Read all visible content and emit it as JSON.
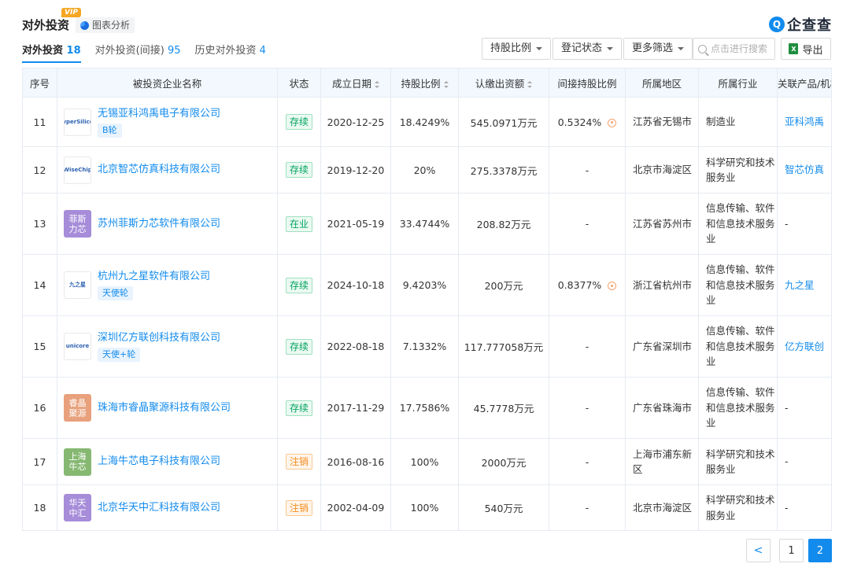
{
  "header": {
    "title": "对外投资",
    "vip": "VIP",
    "chart_button": "图表分析",
    "brand_icon": "Q",
    "brand_name": "企查查"
  },
  "tabs": [
    {
      "label": "对外投资",
      "count": "18"
    },
    {
      "label": "对外投资(间接)",
      "count": "95"
    },
    {
      "label": "历史对外投资",
      "count": "4"
    }
  ],
  "filters": {
    "ratio": "持股比例",
    "status": "登记状态",
    "more": "更多筛选",
    "search_placeholder": "点击进行搜索",
    "export": "导出",
    "excel_icon": "X"
  },
  "columns": [
    "序号",
    "被投资企业名称",
    "状态",
    "成立日期",
    "持股比例",
    "认缴出资额",
    "间接持股比例",
    "所属地区",
    "所属行业",
    "关联产品/机构"
  ],
  "rows": [
    {
      "no": "11",
      "logo_text": "HyperSilicon",
      "logo_bg": "#ffffff",
      "name": "无锡亚科鸿禹电子有限公司",
      "round": "B轮",
      "status": "存续",
      "status_color": "green",
      "date": "2020-12-25",
      "ratio": "18.4249%",
      "capital": "545.0971万元",
      "indirect": "0.5324%",
      "region": "江苏省无锡市",
      "industry": "制造业",
      "product": "亚科鸿禹"
    },
    {
      "no": "12",
      "logo_text": "WiseChip",
      "logo_bg": "#ffffff",
      "name": "北京智芯仿真科技有限公司",
      "round": "",
      "status": "存续",
      "status_color": "green",
      "date": "2019-12-20",
      "ratio": "20%",
      "capital": "275.3378万元",
      "indirect": "-",
      "region": "北京市海淀区",
      "industry": "科学研究和技术服务业",
      "product": "智芯仿真"
    },
    {
      "no": "13",
      "logo_text": "菲斯力芯",
      "logo_bg": "#a68cd9",
      "name": "苏州菲斯力芯软件有限公司",
      "round": "",
      "status": "在业",
      "status_color": "green",
      "date": "2021-05-19",
      "ratio": "33.4744%",
      "capital": "208.82万元",
      "indirect": "-",
      "region": "江苏省苏州市",
      "industry": "信息传输、软件和信息技术服务业",
      "product": "-"
    },
    {
      "no": "14",
      "logo_text": "九之星",
      "logo_bg": "#ffffff",
      "name": "杭州九之星软件有限公司",
      "round": "天使轮",
      "status": "存续",
      "status_color": "green",
      "date": "2024-10-18",
      "ratio": "9.4203%",
      "capital": "200万元",
      "indirect": "0.8377%",
      "region": "浙江省杭州市",
      "industry": "信息传输、软件和信息技术服务业",
      "product": "九之星"
    },
    {
      "no": "15",
      "logo_text": "unicore",
      "logo_bg": "#ffffff",
      "name": "深圳亿方联创科技有限公司",
      "round": "天使+轮",
      "status": "存续",
      "status_color": "green",
      "date": "2022-08-18",
      "ratio": "7.1332%",
      "capital": "117.777058万元",
      "indirect": "-",
      "region": "广东省深圳市",
      "industry": "信息传输、软件和信息技术服务业",
      "product": "亿方联创"
    },
    {
      "no": "16",
      "logo_text": "睿晶聚源",
      "logo_bg": "#e8a17c",
      "name": "珠海市睿晶聚源科技有限公司",
      "round": "",
      "status": "存续",
      "status_color": "green",
      "date": "2017-11-29",
      "ratio": "17.7586%",
      "capital": "45.7778万元",
      "indirect": "-",
      "region": "广东省珠海市",
      "industry": "信息传输、软件和信息技术服务业",
      "product": "-"
    },
    {
      "no": "17",
      "logo_text": "上海牛芯",
      "logo_bg": "#86b872",
      "name": "上海牛芯电子科技有限公司",
      "round": "",
      "status": "注销",
      "status_color": "orange",
      "date": "2016-08-16",
      "ratio": "100%",
      "capital": "2000万元",
      "indirect": "-",
      "region": "上海市浦东新区",
      "industry": "科学研究和技术服务业",
      "product": "-"
    },
    {
      "no": "18",
      "logo_text": "华天中汇",
      "logo_bg": "#a68cd9",
      "name": "北京华天中汇科技有限公司",
      "round": "",
      "status": "注销",
      "status_color": "orange",
      "date": "2002-04-09",
      "ratio": "100%",
      "capital": "540万元",
      "indirect": "-",
      "region": "北京市海淀区",
      "industry": "科学研究和技术服务业",
      "product": "-"
    }
  ],
  "pagination": {
    "prev": "<",
    "pages": [
      "1",
      "2"
    ],
    "current": "2"
  },
  "colors": {
    "accent": "#128bed",
    "header_bg": "#f2f8fe",
    "status_green": "#00a35d",
    "status_orange": "#f28c1e"
  }
}
